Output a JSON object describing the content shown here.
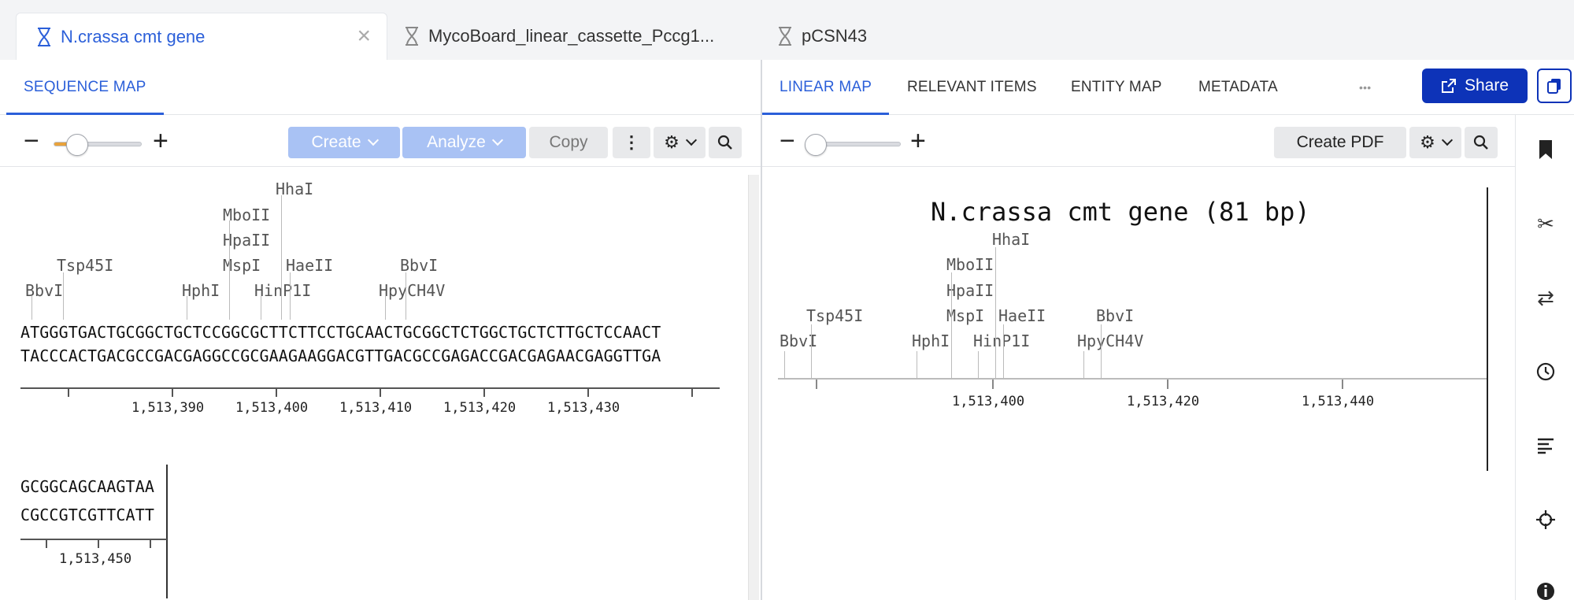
{
  "tabs": [
    {
      "label": "N.crassa cmt gene",
      "active": true,
      "icon": "dna-icon"
    },
    {
      "label": "MycoBoard_linear_cassette_Pccg1...",
      "active": false,
      "icon": "dna-icon"
    },
    {
      "label": "pCSN43",
      "active": false,
      "icon": "dna-icon"
    }
  ],
  "left": {
    "subtab": "SEQUENCE MAP",
    "toolbar": {
      "create": "Create",
      "analyze": "Analyze",
      "copy": "Copy",
      "zoom_minus": "−",
      "zoom_plus": "+",
      "zoom_level": 0.25
    },
    "enzymes": [
      "HhaI",
      "MboII",
      "HpaII",
      "MspI",
      "HaeII",
      "BbvI",
      "Tsp45I",
      "BbvI",
      "HphI",
      "HinP1I",
      "HpyCH4V"
    ],
    "seq_top_1": "ATGGGTGACTGCGGCTGCTCCGGCGCTTCTTCCTGCAACTGCGGCTCTGGCTGCTCTTGCTCCAACT",
    "seq_bottom_1": "TACCCACTGACGCCGACGAGGCCGCGAAGAAGGACGTTGACGCCGAGACCGACGAGAACGAGGTTGA",
    "ruler_1_labels": [
      "1,513,390",
      "1,513,400",
      "1,513,410",
      "1,513,420",
      "1,513,430"
    ],
    "seq_top_2": "GCGGCAGCAAGTAA",
    "seq_bottom_2": "CGCCGTCGTTCATT",
    "ruler_2_labels": [
      "1,513,450"
    ]
  },
  "right": {
    "subtabs": [
      "LINEAR MAP",
      "RELEVANT ITEMS",
      "ENTITY MAP",
      "METADATA"
    ],
    "more": "•••",
    "share": "Share",
    "create_pdf": "Create PDF",
    "map_title": "N.crassa cmt gene (81 bp)",
    "enzymes": [
      "HhaI",
      "MboII",
      "HpaII",
      "MspI",
      "HaeII",
      "BbvI",
      "Tsp45I",
      "BbvI",
      "HphI",
      "HinP1I",
      "HpyCH4V"
    ],
    "axis_labels": [
      "1,513,400",
      "1,513,420",
      "1,513,440"
    ],
    "zoom_level": 0.05
  },
  "rail_icons": [
    "bookmark-icon",
    "scissors-icon",
    "swap-icon",
    "history-icon",
    "align-icon",
    "target-icon",
    "info-icon"
  ],
  "colors": {
    "accent": "#2b5fd9",
    "share_button": "#0d33b8",
    "create_button": "#a9c2f4",
    "slider_fill": "#e9a23b"
  }
}
